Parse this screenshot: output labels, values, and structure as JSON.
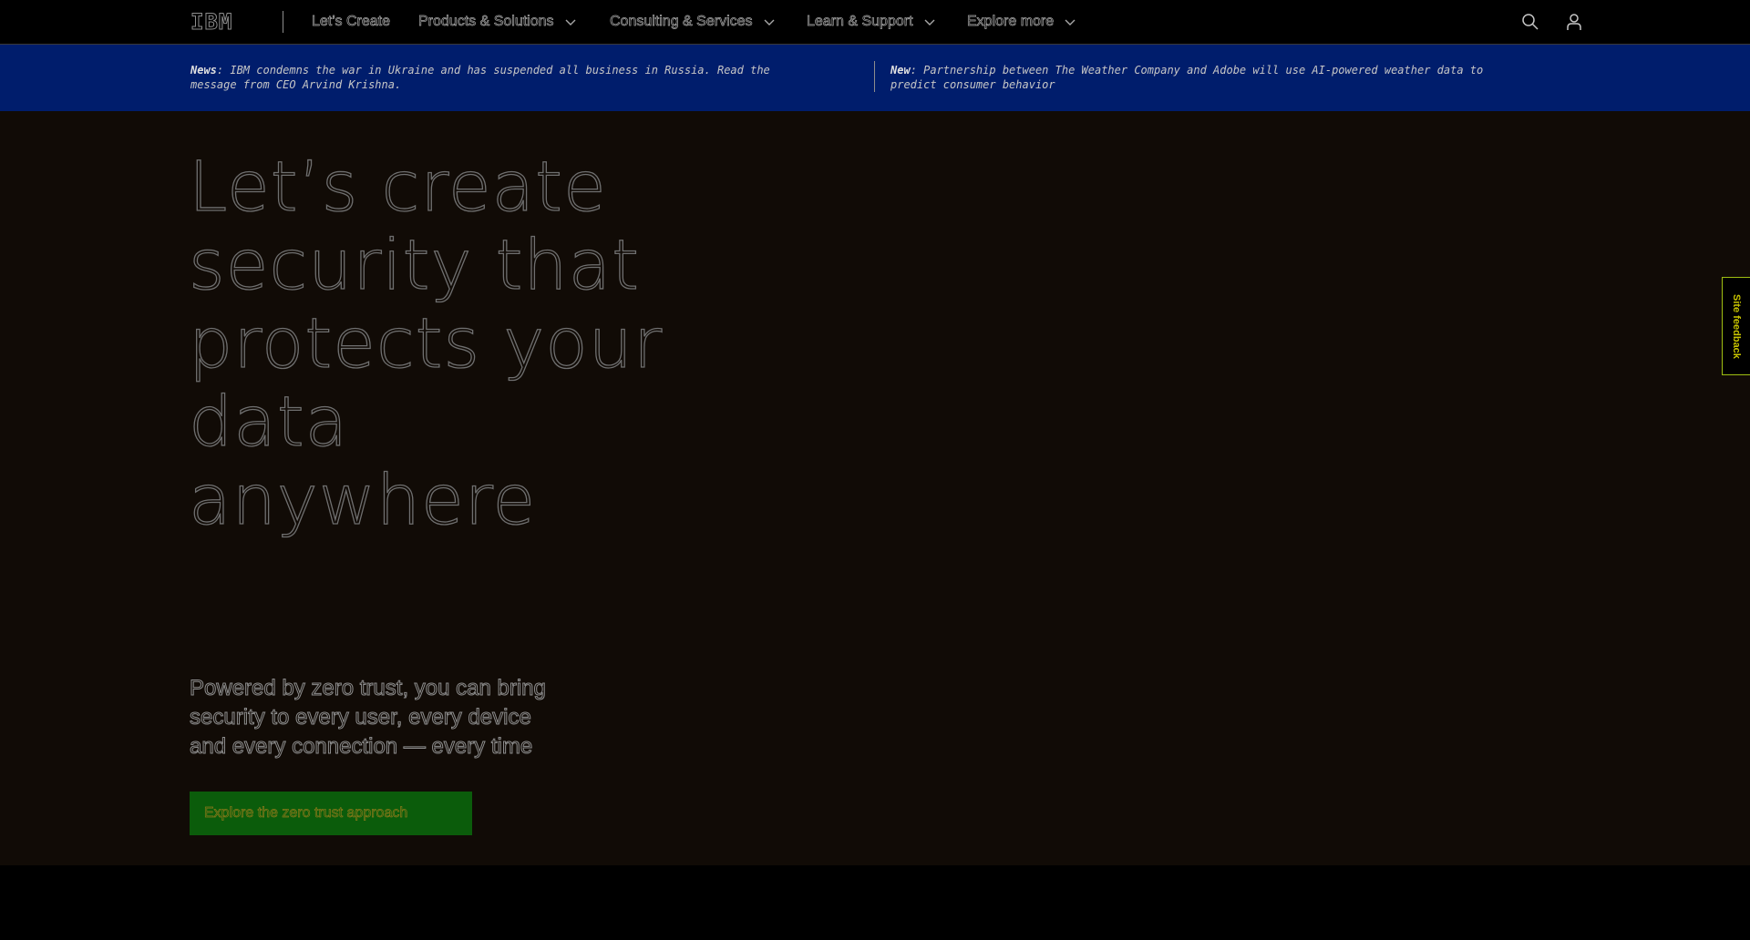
{
  "header": {
    "logo_text": "IBM",
    "nav": [
      {
        "label": "Let’s Create",
        "has_dropdown": false
      },
      {
        "label": "Products & Solutions",
        "has_dropdown": true
      },
      {
        "label": "Consulting & Services",
        "has_dropdown": true
      },
      {
        "label": "Learn & Support",
        "has_dropdown": true
      },
      {
        "label": "Explore more",
        "has_dropdown": true
      }
    ],
    "icons": [
      "search-icon",
      "user-icon"
    ]
  },
  "news": [
    {
      "prefix": "News",
      "text": ": IBM condemns the war in Ukraine and has suspended all business in Russia. Read the message from CEO Arvind Krishna."
    },
    {
      "prefix": "New",
      "text": ": Partnership between The Weather Company and Adobe will use AI-powered weather data to predict consumer behavior"
    }
  ],
  "hero": {
    "headline": "Let’s create security that protects your data anywhere",
    "subtext": "Powered by zero trust, you can bring security to every user, every device and every connection — every time",
    "cta_label": "Explore the zero trust approach"
  },
  "feedback": {
    "label": "Site feedback"
  },
  "colors": {
    "news_bar_bg": "#001d6c",
    "hero_bg": "#110b06",
    "cta_bg": "#0b5c0b",
    "feedback_border": "#9fbf12"
  }
}
